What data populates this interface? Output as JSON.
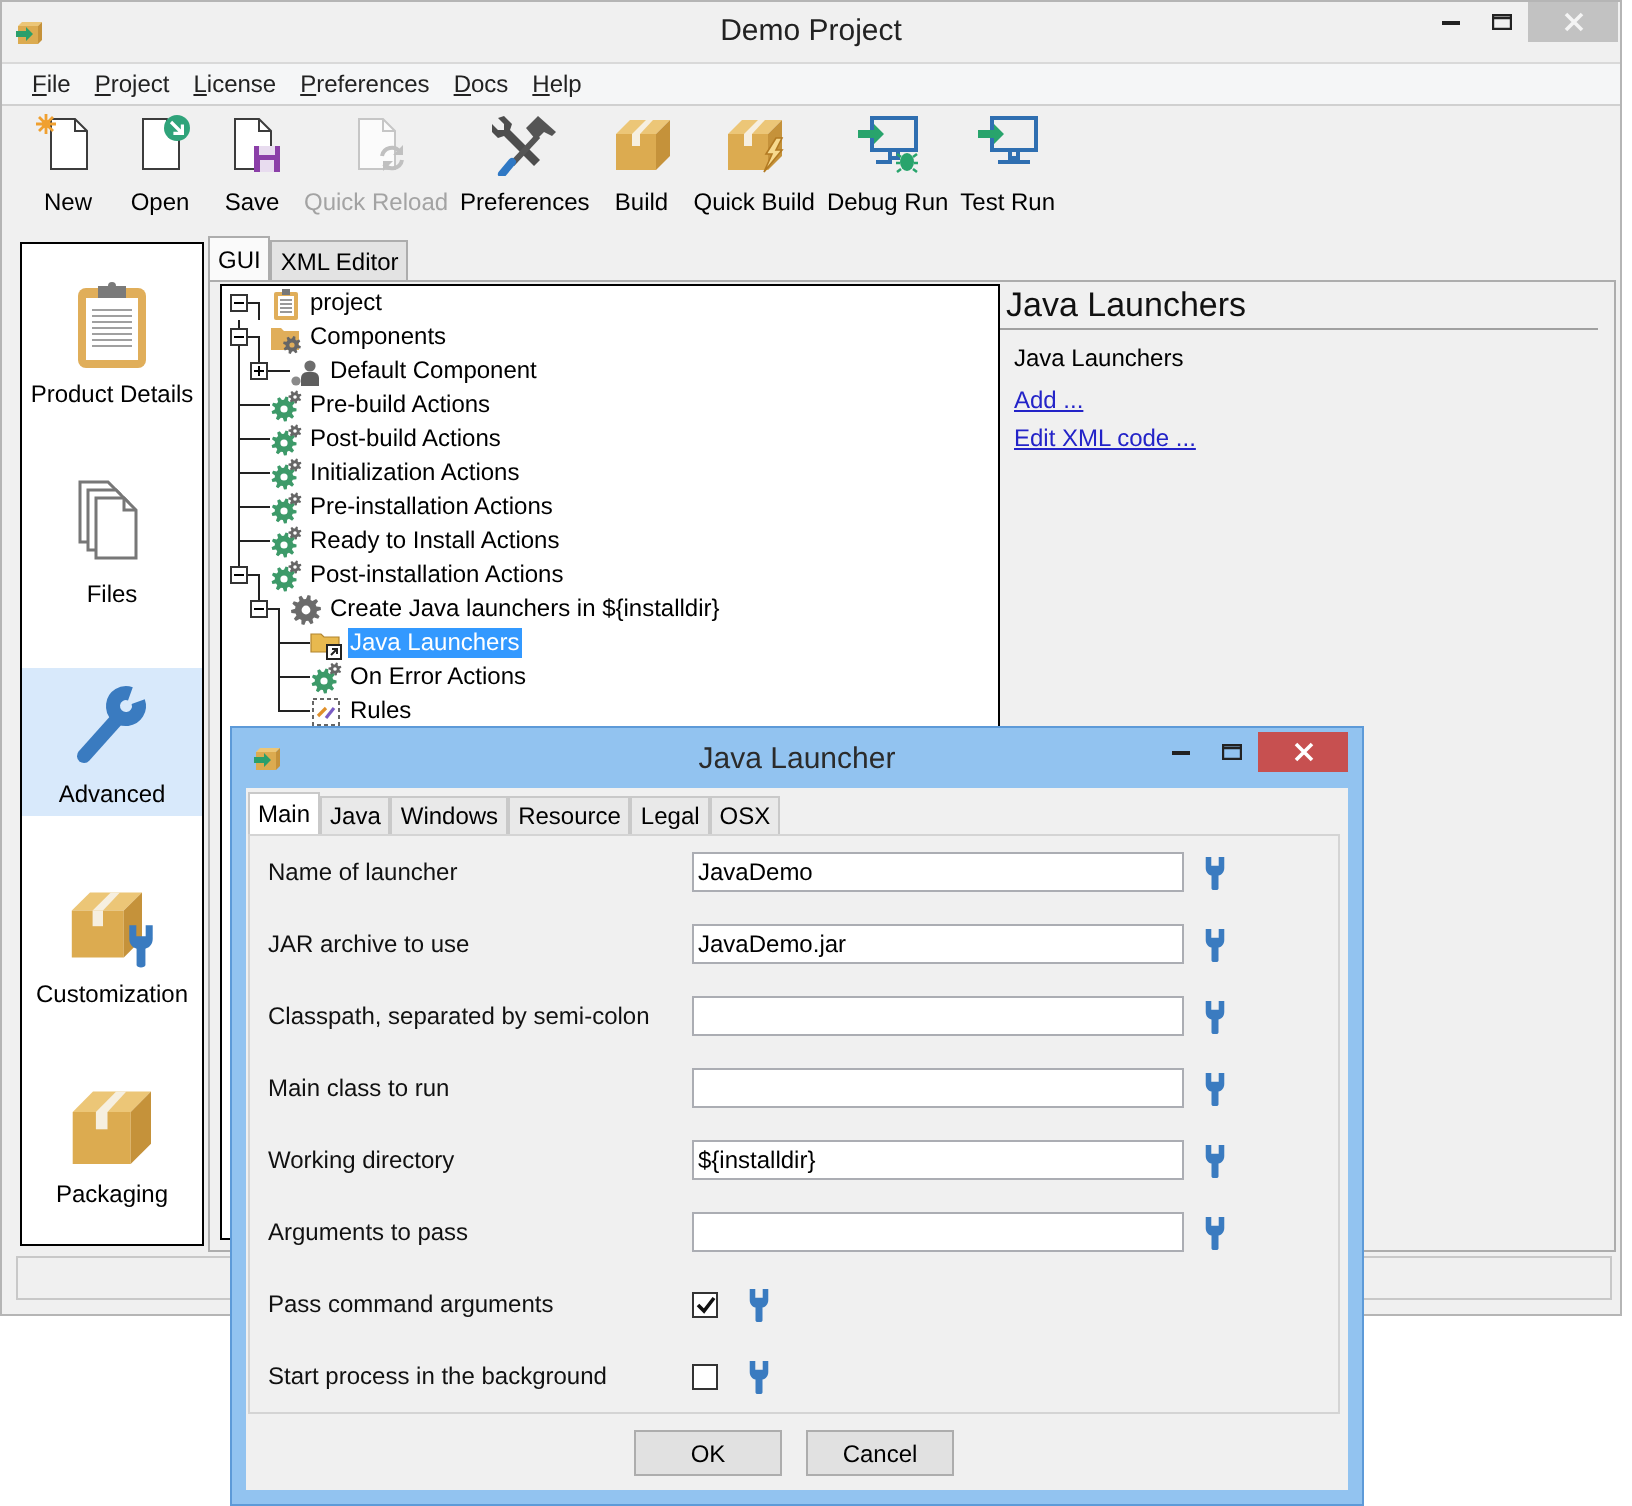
{
  "window": {
    "title": "Demo Project"
  },
  "menu": [
    "File",
    "Project",
    "License",
    "Preferences",
    "Docs",
    "Help"
  ],
  "toolbar": [
    {
      "label": "New",
      "kind": "new",
      "disabled": false
    },
    {
      "label": "Open",
      "kind": "open",
      "disabled": false
    },
    {
      "label": "Save",
      "kind": "save",
      "disabled": false
    },
    {
      "label": "Quick Reload",
      "kind": "reload",
      "disabled": true
    },
    {
      "label": "Preferences",
      "kind": "preferences",
      "disabled": false
    },
    {
      "label": "Build",
      "kind": "build",
      "disabled": false
    },
    {
      "label": "Quick Build",
      "kind": "quick_build",
      "disabled": false
    },
    {
      "label": "Debug Run",
      "kind": "debug_run",
      "disabled": false
    },
    {
      "label": "Test Run",
      "kind": "test_run",
      "disabled": false
    }
  ],
  "sidebar": {
    "items": [
      {
        "label": "Product Details",
        "kind": "details",
        "selected": false
      },
      {
        "label": "Files",
        "kind": "files",
        "selected": false
      },
      {
        "label": "Advanced",
        "kind": "advanced",
        "selected": true
      },
      {
        "label": "Customization",
        "kind": "customization",
        "selected": false
      },
      {
        "label": "Packaging",
        "kind": "packaging",
        "selected": false
      }
    ]
  },
  "tabs": [
    {
      "label": "GUI",
      "selected": true
    },
    {
      "label": "XML Editor",
      "selected": false
    }
  ],
  "tree": [
    {
      "label": "project",
      "kind": "project",
      "expanded": true,
      "selected": false,
      "children": [
        {
          "label": "Components",
          "kind": "folder_gear",
          "expanded": true,
          "selected": false,
          "children": [
            {
              "label": "Default Component",
              "kind": "component",
              "expanded": false,
              "selected": false
            }
          ]
        },
        {
          "label": "Pre-build Actions",
          "kind": "actions",
          "selected": false
        },
        {
          "label": "Post-build Actions",
          "kind": "actions",
          "selected": false
        },
        {
          "label": "Initialization Actions",
          "kind": "actions",
          "selected": false
        },
        {
          "label": "Pre-installation Actions",
          "kind": "actions",
          "selected": false
        },
        {
          "label": "Ready to Install Actions",
          "kind": "actions",
          "selected": false
        },
        {
          "label": "Post-installation Actions",
          "kind": "actions",
          "expanded": true,
          "selected": false,
          "children": [
            {
              "label": "Create Java launchers in ${installdir}",
              "kind": "action",
              "expanded": true,
              "selected": false,
              "children": [
                {
                  "label": "Java Launchers",
                  "kind": "launchers",
                  "selected": true
                },
                {
                  "label": "On Error Actions",
                  "kind": "actions",
                  "selected": false
                },
                {
                  "label": "Rules",
                  "kind": "rules",
                  "selected": false
                }
              ]
            }
          ]
        }
      ]
    }
  ],
  "details": {
    "title": "Java Launchers",
    "subtitle": "Java Launchers",
    "links": [
      "Add ...",
      "Edit XML code ..."
    ]
  },
  "dialog": {
    "title": "Java Launcher",
    "tabs": [
      {
        "label": "Main",
        "selected": true
      },
      {
        "label": "Java",
        "selected": false
      },
      {
        "label": "Windows",
        "selected": false
      },
      {
        "label": "Resource",
        "selected": false
      },
      {
        "label": "Legal",
        "selected": false
      },
      {
        "label": "OSX",
        "selected": false
      }
    ],
    "fields": [
      {
        "label": "Name of launcher",
        "kind": "text",
        "value": "JavaDemo"
      },
      {
        "label": "JAR archive to use",
        "kind": "text",
        "value": "JavaDemo.jar"
      },
      {
        "label": "Classpath, separated by semi-colon",
        "kind": "text"
      },
      {
        "label": "Main class to run",
        "kind": "text"
      },
      {
        "label": "Working directory",
        "kind": "text",
        "value": "${installdir}"
      },
      {
        "label": "Arguments to pass",
        "kind": "text"
      },
      {
        "label": "Pass command arguments",
        "kind": "checkbox",
        "checked": true
      },
      {
        "label": "Start process in the background",
        "kind": "checkbox",
        "checked": false
      }
    ],
    "buttons": [
      "OK",
      "Cancel"
    ]
  }
}
